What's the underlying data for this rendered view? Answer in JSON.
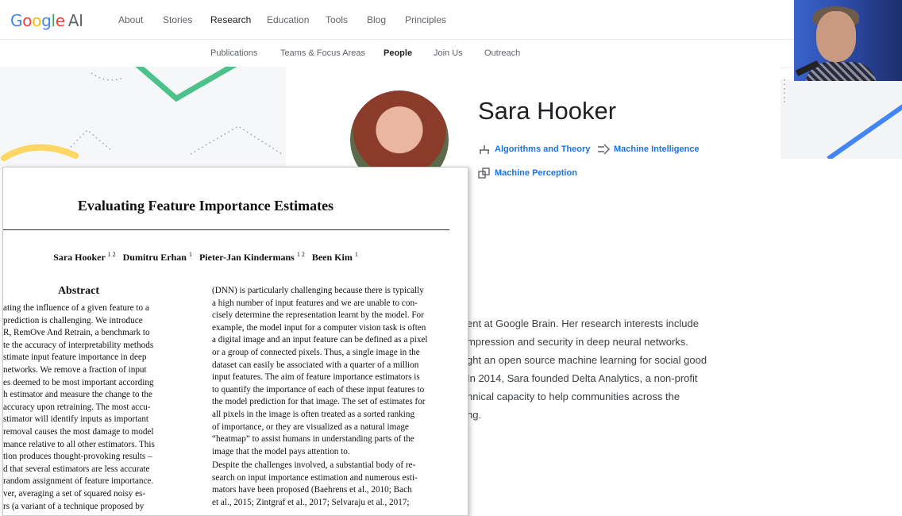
{
  "logo": {
    "google": "Google",
    "ai": "AI"
  },
  "nav": {
    "items": [
      "About",
      "Stories",
      "Research",
      "Education",
      "Tools",
      "Blog",
      "Principles"
    ],
    "active": "Research"
  },
  "subnav": {
    "items": [
      "Publications",
      "Teams & Focus Areas",
      "People",
      "Join Us",
      "Outreach"
    ],
    "active": "People"
  },
  "profile": {
    "name": "Sara Hooker",
    "areas": [
      "Algorithms and Theory",
      "Machine Intelligence",
      "Machine Perception"
    ],
    "bio_lines": [
      "ent at Google Brain. Her research interests include",
      "mpression and security in deep neural networks.",
      "ght an open source machine learning for social good",
      "In 2014, Sara founded Delta Analytics, a non-profit",
      "hnical capacity to help communities across the",
      "ng."
    ]
  },
  "paper": {
    "title": "Evaluating Feature Importance Estimates",
    "authors": [
      {
        "name": "Sara Hooker",
        "aff": "1 2"
      },
      {
        "name": "Dumitru Erhan",
        "aff": "1"
      },
      {
        "name": "Pieter-Jan Kindermans",
        "aff": "1 2"
      },
      {
        "name": "Been Kim",
        "aff": "1"
      }
    ],
    "abstract_heading": "Abstract",
    "left_lines": [
      "ating the influence of a given feature to a",
      " prediction is challenging.  We introduce",
      "R, RemOve And Retrain, a benchmark to",
      "te the accuracy of interpretability methods",
      "stimate input feature importance in deep",
      " networks. We remove a fraction of input",
      "es deemed to be most important according",
      "h estimator and measure the change to the",
      " accuracy upon retraining. The most accu-",
      "stimator will identify inputs as important",
      " removal causes the most damage to model",
      "mance relative to all other estimators. This",
      "tion produces thought-provoking results –",
      "d that several estimators are less accurate",
      " random assignment of feature importance.",
      "ver, averaging a set of squared noisy es-",
      "rs (a variant of a technique proposed by"
    ],
    "right_lines": [
      "(DNN) is particularly challenging because there is typically",
      "a high number of input features and we are unable to con-",
      "cisely determine the representation learnt by the model. For",
      "example, the model input for a computer vision task is often",
      "a digital image and an input feature can be defined as a pixel",
      "or a group of connected pixels. Thus, a single image in the",
      "dataset can easily be associated with a quarter of a million",
      "input features. The aim of feature importance estimators is",
      "to quantify the importance of each of these input features to",
      "the model prediction for that image. The set of estimates for",
      "all pixels in the image is often treated as a sorted ranking",
      "of importance, or they are visualized as a natural image",
      "“heatmap” to assist humans in understanding parts of the",
      "image that the model pays attention to."
    ],
    "right_lines_2": [
      "Despite the challenges involved, a substantial body of re-",
      "search on input importance estimation and numerous esti-",
      "mators have been proposed  (Baehrens et al., 2010; Bach",
      "et al., 2015; Zintgraf et al., 2017; Selvaraju et al., 2017;"
    ]
  },
  "colors": {
    "link": "#1a73e8",
    "green": "#34a853",
    "yellow": "#fbbc05",
    "blue": "#4285f4"
  }
}
